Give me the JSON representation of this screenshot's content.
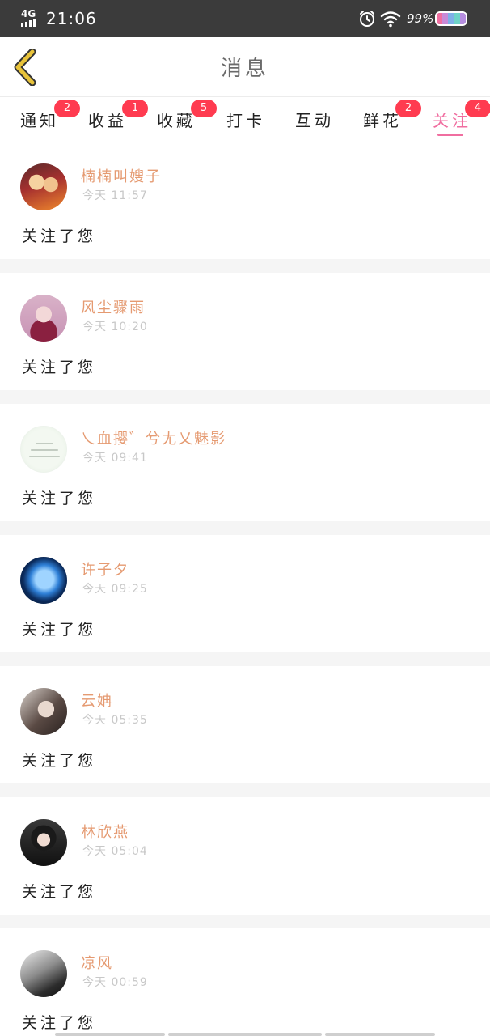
{
  "status_bar": {
    "network": "4G",
    "time": "21:06",
    "battery_percent": "99%",
    "icons": [
      "signal-icon",
      "alarm-icon",
      "wifi-icon",
      "battery-icon"
    ],
    "battery_colors": [
      "#f06ea0",
      "#c98ad8",
      "#7fb0e8",
      "#6fd3c8",
      "#b68de0"
    ]
  },
  "header": {
    "title": "消息",
    "back_icon": "chevron-left-icon",
    "back_color": "#e8c33a"
  },
  "tabs": [
    {
      "label": "通知",
      "badge": "2"
    },
    {
      "label": "收益",
      "badge": "1"
    },
    {
      "label": "收藏",
      "badge": "5"
    },
    {
      "label": "打卡",
      "badge": ""
    },
    {
      "label": "互动",
      "badge": ""
    },
    {
      "label": "鲜花",
      "badge": "2"
    },
    {
      "label": "关注",
      "badge": "4",
      "active": true
    }
  ],
  "colors": {
    "accent": "#f06ea0",
    "username": "#e59a71",
    "badge": "#ff3b50",
    "timestamp": "#c8c8c8"
  },
  "messages": [
    {
      "username": "楠楠叫嫂子",
      "time": "今天 11:57",
      "text": "关注了您"
    },
    {
      "username": "风尘骤雨",
      "time": "今天 10:20",
      "text": "关注了您"
    },
    {
      "username": "乀血撄゛兮尢乂魅影",
      "time": "今天 09:41",
      "text": "关注了您"
    },
    {
      "username": "许子夕",
      "time": "今天 09:25",
      "text": "关注了您"
    },
    {
      "username": "云姌",
      "time": "今天 05:35",
      "text": "关注了您"
    },
    {
      "username": "林欣燕",
      "time": "今天 05:04",
      "text": "关注了您"
    },
    {
      "username": "凉风",
      "time": "今天 00:59",
      "text": "关注了您"
    }
  ]
}
